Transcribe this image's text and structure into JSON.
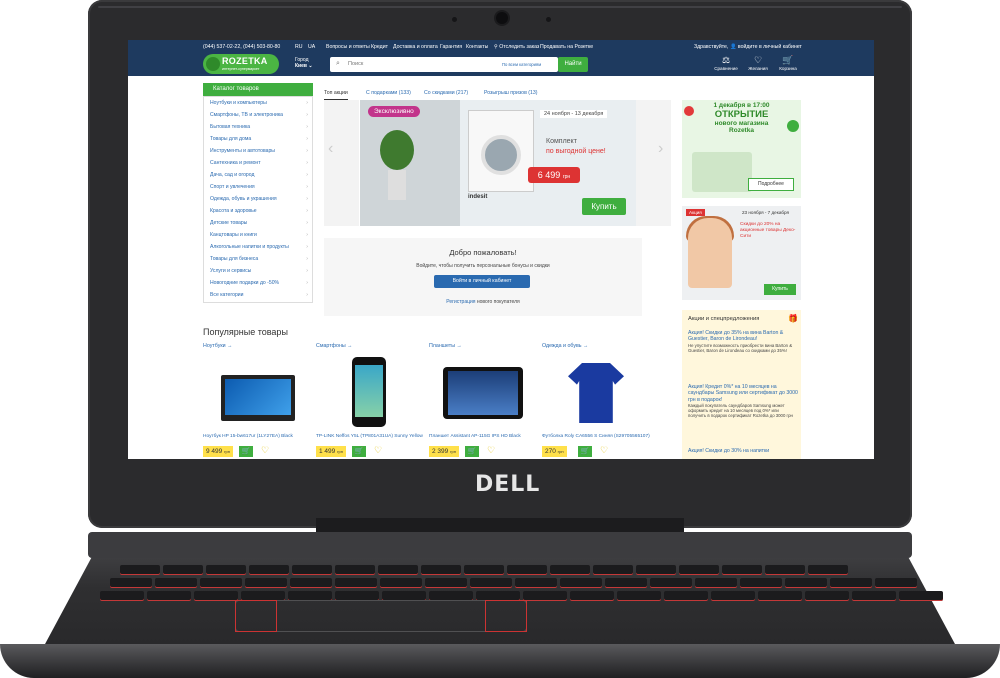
{
  "laptop": {
    "brand": "DELL"
  },
  "topbar": {
    "phone": "(044) 537-02-22, (044) 503-80-80",
    "lang_ru": "RU",
    "lang_ua": "UA",
    "links": [
      "Вопросы и ответы",
      "Кредит",
      "Доставка и оплата",
      "Гарантия",
      "Контакты"
    ],
    "track": "Отследить заказ",
    "sell": "Продавать на Розетке",
    "greeting": "Здравствуйте,",
    "cabinet": "войдите в личный кабинет"
  },
  "header": {
    "logo": "ROZETKA",
    "logo_sub": "интернет-супермаркет",
    "city_label": "Город",
    "city": "Киев",
    "search_placeholder": "Поиск",
    "search_category": "По всем категориям",
    "search_button": "Найти",
    "compare": "Сравнение",
    "wishlist": "Желания",
    "cart": "Корзина"
  },
  "catalog": {
    "button": "Каталог товаров",
    "items": [
      "Ноутбуки и компьютеры",
      "Смартфоны, ТВ и электроника",
      "Бытовая техника",
      "Товары для дома",
      "Инструменты и автотовары",
      "Сантехника и ремонт",
      "Дача, сад и огород",
      "Спорт и увлечения",
      "Одежда, обувь и украшения",
      "Красота и здоровье",
      "Детские товары",
      "Канцтовары и книги",
      "Алкогольные напитки и продукты",
      "Товары для бизнеса",
      "Услуги и сервисы",
      "Новогодние подарки до -50%",
      "Все категории"
    ]
  },
  "tabs": [
    "Топ акции",
    "С подарками (133)",
    "Со скидками (217)",
    "Розыгрыш призов (13)"
  ],
  "banner": {
    "badge": "Эксклюзивно",
    "dates": "24 ноября - 13 декабря",
    "kit": "Комплект",
    "kit_price_line": "по выгодной цене!",
    "price": "6 499",
    "currency": "грн",
    "brand": "indesit",
    "buy": "Купить"
  },
  "welcome": {
    "title": "Добро пожаловать!",
    "subtitle": "Войдите, чтобы получить персональные бонусы и скидки",
    "login": "Войти в личный кабинет",
    "register_link": "Регистрация",
    "register_rest": "нового покупателя"
  },
  "promo_store": {
    "line1": "1 декабря в 17:00",
    "line2": "ОТКРЫТИЕ",
    "line3": "нового магазина",
    "line4": "Rozetka",
    "more": "Подробнее"
  },
  "promo_deco": {
    "badge": "Акция",
    "dates": "23 ноября - 7 декабря",
    "text": "Скидки до 20% на акционные товары Деко-Сити",
    "button": "Купить"
  },
  "offers": {
    "title": "Акции и спецпредложения",
    "items": [
      {
        "title": "Акция! Скидки до 35% на вина Barton & Guestier, Baron de Lirondeau!",
        "desc": "Не упустите возможность приобрести вина Barton & Guestier, Baron de Lirondeau со скидками до 35%!"
      },
      {
        "title": "Акция! Кредит 0%* на 10 месяцев на саундбары Samsung или сертификат до 3000 грн в подарок!",
        "desc": "Каждый покупатель саундбаров Samsung может оформить кредит на 10 месяцев под 0%* или получить в подарок сертификат Rozetka до 3000 грн"
      },
      {
        "title": "Акция! Скидки до 30% на напитки",
        "desc": ""
      }
    ]
  },
  "popular": {
    "title": "Популярные товары",
    "products": [
      {
        "category": "Ноутбуки →",
        "name": "Ноутбук HP 15-bw617ur (1LY27EA) Black",
        "price": "9 499",
        "currency": "грн"
      },
      {
        "category": "Смартфоны →",
        "name": "TP-LINK Neffos Y5L (TP801A31UA) Sunny Yellow",
        "price": "1 499",
        "currency": "грн"
      },
      {
        "category": "Планшеты →",
        "name": "Планшет Assistant AP-115G IPS HD Black",
        "price": "2 399",
        "currency": "грн"
      },
      {
        "category": "Одежда и обувь →",
        "name": "Футболка Roly CA6556 S Синяя (S29705565107)",
        "price": "270",
        "currency": "грн"
      }
    ]
  },
  "colors": {
    "header": "#1e3a5f",
    "green": "#3fae3f",
    "link": "#2a6ab0",
    "promo_red": "#d33"
  }
}
